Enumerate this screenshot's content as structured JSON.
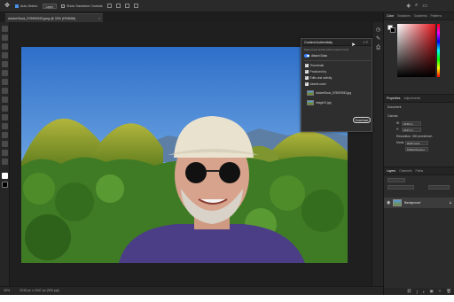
{
  "options_bar": {
    "auto_select_label": "Auto-Select:",
    "auto_select_value": "Layer",
    "transform_label": "Show Transform Controls"
  },
  "document_tab": {
    "title": "AdobeStock_575900933.jpeg @ 33% (RGB/8#)",
    "close": "×"
  },
  "status_bar": {
    "zoom": "33%",
    "doc_info": "3239 px x 2447 px (300 ppi)"
  },
  "panel_tabs_top": [
    "Color",
    "Swatches",
    "Gradients",
    "Patterns"
  ],
  "properties": {
    "tabs": [
      "Properties",
      "Adjustments"
    ],
    "document_label": "Document",
    "canvas_label": "Canvas",
    "w_label": "W",
    "w_value": "3239 px",
    "h_label": "H",
    "h_value": "2447 px",
    "resolution": "Resolution: 300 pixels/inch",
    "mode_label": "Mode",
    "mode_value": "RGB Color",
    "bits_value": "8 Bits/Channel"
  },
  "layers": {
    "tabs": [
      "Layers",
      "Channels",
      "Paths"
    ],
    "layer_name": "Background"
  },
  "content_authenticity": {
    "title": "Content Authenticity",
    "description": "Help people decide what content to trust",
    "attach_label": "Attach Data",
    "options": [
      "Thumbnail",
      "Produced by",
      "Edits and activity",
      "Assets used"
    ],
    "assets": [
      "AdobeStock_575900933.jpg",
      "image01.jpg"
    ],
    "download_label": "Download"
  },
  "colors": {
    "accent": "#3b82f6",
    "panel_bg": "#2b2b2b",
    "app_bg": "#1e1e1e"
  }
}
